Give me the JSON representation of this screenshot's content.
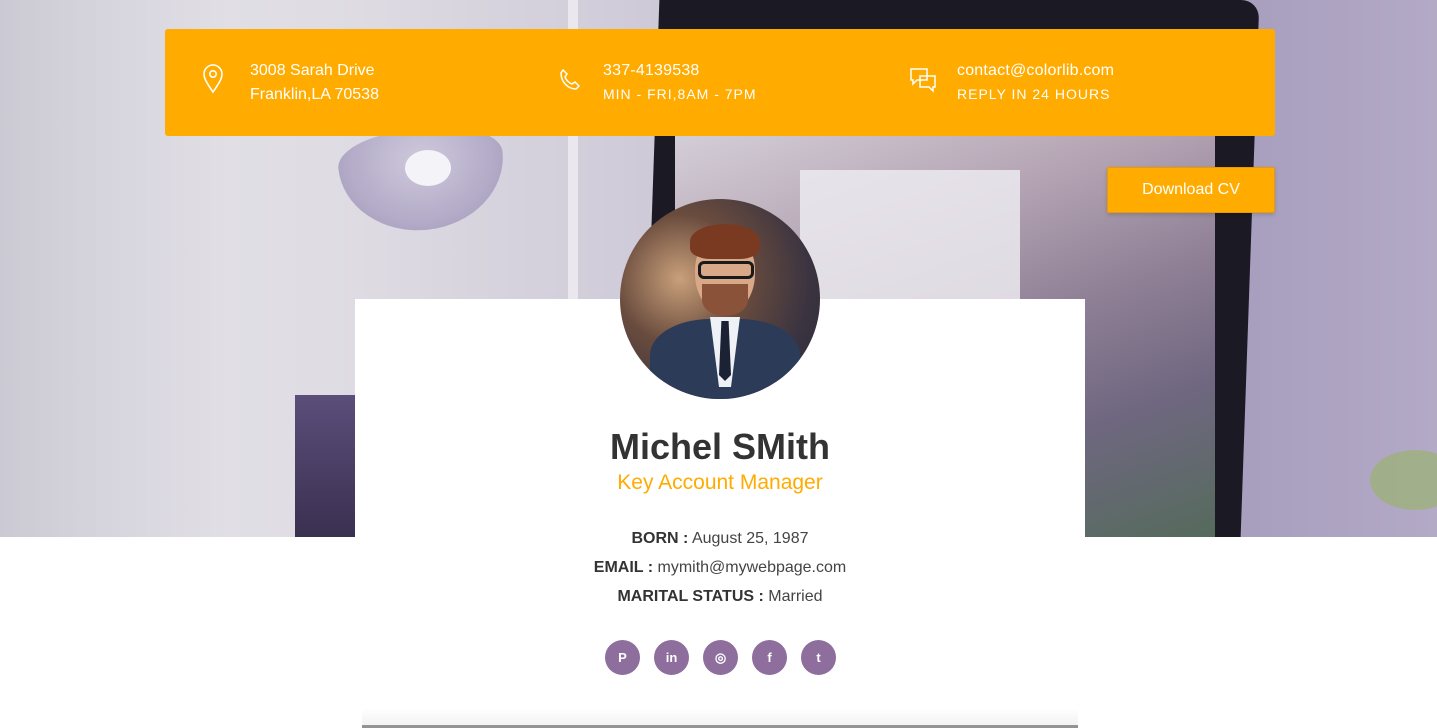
{
  "contact": {
    "address_line1": "3008 Sarah Drive",
    "address_line2": "Franklin,LA 70538",
    "phone": "337-4139538",
    "phone_hours": "MIN - FRI,8AM - 7PM",
    "email": "contact@colorlib.com",
    "email_note": "REPLY IN 24 HOURS",
    "icons": [
      "location-pin-icon",
      "phone-icon",
      "chat-bubbles-icon"
    ]
  },
  "download_button": "Download CV",
  "profile": {
    "name": "Michel SMith",
    "role": "Key Account Manager",
    "born_label": "BORN :",
    "born_value": "August 25, 1987",
    "email_label": "EMAIL :",
    "email_value": "mymith@mywebpage.com",
    "marital_label": "MARITAL STATUS :",
    "marital_value": "Married"
  },
  "socials": [
    {
      "name": "pinterest-icon",
      "glyph": "P"
    },
    {
      "name": "linkedin-icon",
      "glyph": "in"
    },
    {
      "name": "instagram-icon",
      "glyph": "◎"
    },
    {
      "name": "facebook-icon",
      "glyph": "f"
    },
    {
      "name": "twitter-icon",
      "glyph": "t"
    }
  ],
  "colors": {
    "accent": "#ffab00",
    "social": "#8e6e9c",
    "text_dark": "#333333"
  }
}
